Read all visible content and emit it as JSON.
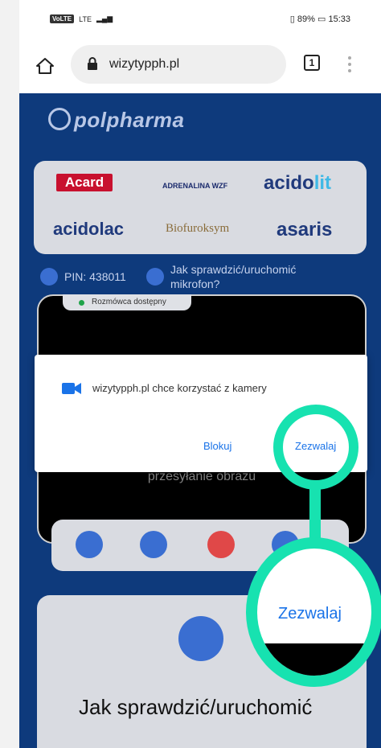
{
  "status_bar": {
    "carrier_badge": "VoLTE",
    "network": "LTE",
    "battery": "89%",
    "time": "15:33"
  },
  "browser": {
    "url": "wizytypph.pl",
    "tabs_count": "1"
  },
  "page": {
    "brand": "polpharma",
    "logos": [
      "Acard",
      "ADRENALINA WZF",
      "acidolit",
      "acidolac",
      "Biofuroksym",
      "asaris"
    ],
    "pin_label": "PIN: 438011",
    "help_link": "Jak sprawdzić/uruchomić mikrofon?",
    "availability": "Rozmówca dostępny",
    "video_status": "przesyłanie obrazu",
    "info_title": "Jak sprawdzić/uruchomić"
  },
  "dialog": {
    "message": "wizytypph.pl chce korzystać z kamery",
    "block_label": "Blokuj",
    "allow_label": "Zezwalaj"
  },
  "magnifier": {
    "label": "Zezwalaj"
  },
  "colors": {
    "page_bg": "#0e3a7c",
    "accent_teal": "#17e2b0",
    "link_blue": "#1a73e8"
  }
}
